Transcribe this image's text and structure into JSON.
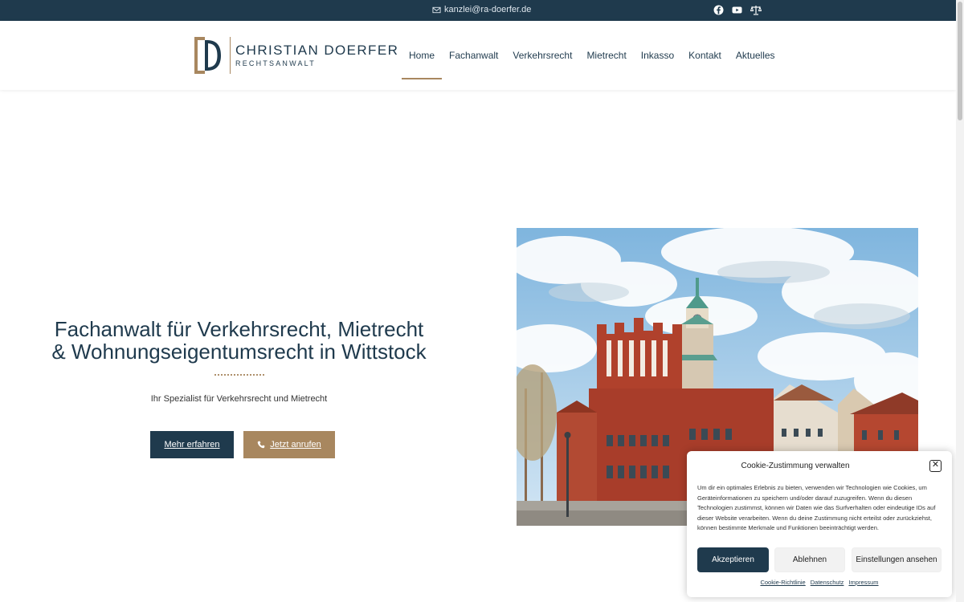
{
  "topbar": {
    "email": "kanzlei@ra-doerfer.de",
    "icons": [
      "mail-icon",
      "facebook-icon",
      "youtube-icon",
      "scales-icon"
    ]
  },
  "header": {
    "logo_name": "CHRISTIAN DOERFER",
    "logo_sub": "RECHTSANWALT",
    "nav": [
      {
        "label": "Home",
        "active": true
      },
      {
        "label": "Fachanwalt"
      },
      {
        "label": "Verkehrsrecht"
      },
      {
        "label": "Mietrecht"
      },
      {
        "label": "Inkasso"
      },
      {
        "label": "Kontakt"
      },
      {
        "label": "Aktuelles"
      }
    ]
  },
  "hero": {
    "title_line1": "Fachanwalt für Verkehrsrecht, Mietrecht",
    "title_line2": "& Wohnungseigentumsrecht in Wittstock",
    "subtitle": "Ihr Spezialist für Verkehrsrecht und Mietrecht",
    "btn_more": "Mehr erfahren",
    "btn_call": "Jetzt anrufen"
  },
  "cookie": {
    "title": "Cookie-Zustimmung verwalten",
    "text": "Um dir ein optimales Erlebnis zu bieten, verwenden wir Technologien wie Cookies, um Geräteinformationen zu speichern und/oder darauf zuzugreifen. Wenn du diesen Technologien zustimmst, können wir Daten wie das Surfverhalten oder eindeutige IDs auf dieser Website verarbeiten. Wenn du deine Zustimmung nicht erteilst oder zurückziehst, können bestimmte Merkmale und Funktionen beeinträchtigt werden.",
    "accept": "Akzeptieren",
    "deny": "Ablehnen",
    "settings": "Einstellungen ansehen",
    "links": [
      "Cookie-Richtlinie",
      "Datenschutz",
      "Impressum"
    ]
  },
  "colors": {
    "navy": "#1f3a4d",
    "gold": "#a8875f"
  }
}
